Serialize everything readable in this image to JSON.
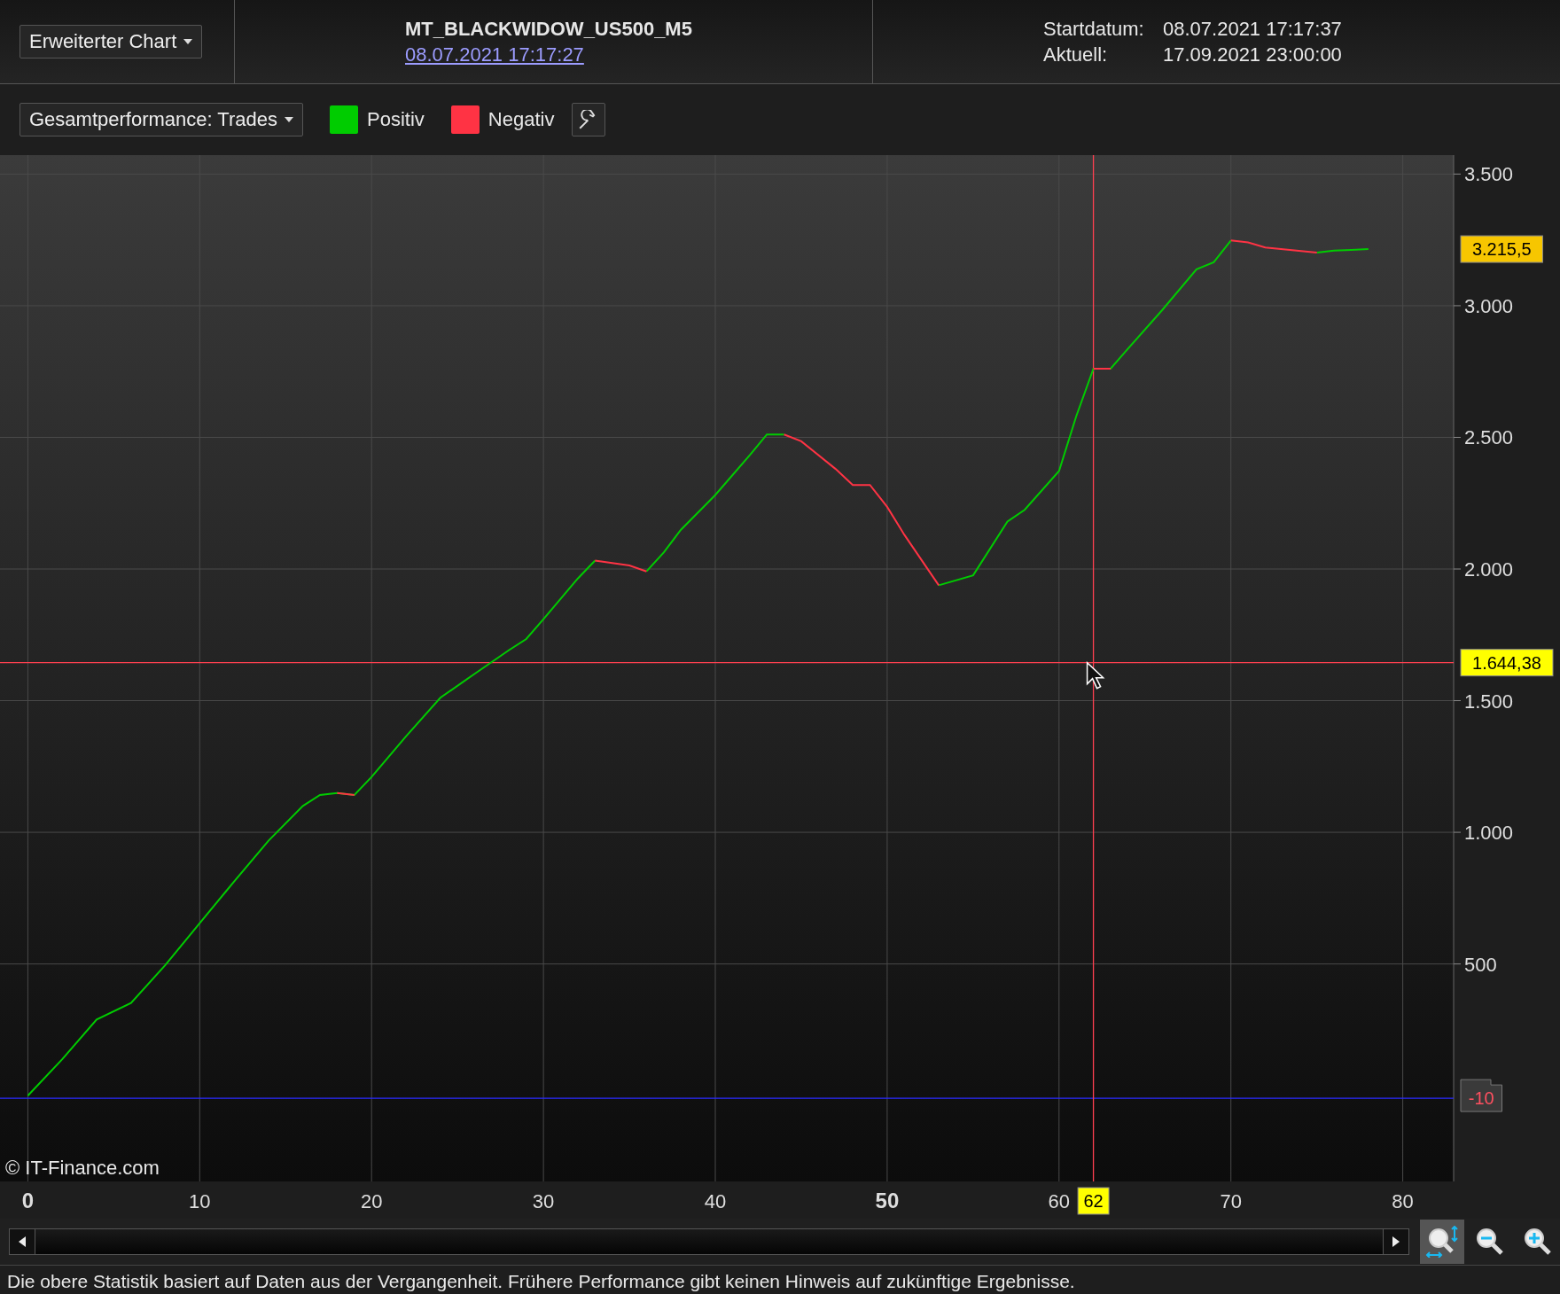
{
  "header": {
    "chart_menu": "Erweiterter Chart",
    "title": "MT_BLACKWIDOW_US500_M5",
    "date_link": "08.07.2021 17:17:27",
    "info": [
      {
        "label": "Startdatum:",
        "value": "08.07.2021 17:17:37"
      },
      {
        "label": "Aktuell:",
        "value": "17.09.2021 23:00:00"
      }
    ]
  },
  "toolbar": {
    "view_menu": "Gesamtperformance: Trades"
  },
  "chart": {
    "copyright": "© IT-Finance.com",
    "chart_data": {
      "type": "line",
      "x": [
        0,
        2,
        4,
        6,
        8,
        10,
        12,
        14,
        16,
        17,
        18,
        19,
        20,
        22,
        24,
        26,
        28,
        29,
        30,
        32,
        33,
        35,
        36,
        37,
        38,
        40,
        42,
        43,
        44,
        45,
        47,
        48,
        49,
        50,
        51,
        53,
        55,
        57,
        58,
        60,
        61,
        62,
        63,
        64,
        66,
        68,
        69,
        70,
        71,
        72,
        75,
        76,
        77,
        78
      ],
      "series": [
        {
          "name": "Positiv",
          "color": "#00cc00",
          "values": [
            0,
            138,
            289,
            352,
            496,
            655,
            813,
            968,
            1100,
            1142,
            1149,
            1142,
            1210,
            1364,
            1511,
            1602,
            1692,
            1734,
            1809,
            1964,
            2032,
            null,
            1991,
            2063,
            2149,
            2281,
            2432,
            2511,
            2511,
            null,
            null,
            null,
            null,
            null,
            null,
            1938,
            1976,
            2180,
            2225,
            2372,
            2580,
            2761,
            2761,
            2836,
            2983,
            3138,
            3165,
            3248,
            null,
            null,
            3202,
            3209,
            3212,
            3215
          ]
        },
        {
          "name": "Negativ",
          "color": "#ff3344",
          "values": [
            null,
            null,
            null,
            null,
            null,
            null,
            null,
            null,
            null,
            null,
            1149,
            1142,
            null,
            null,
            null,
            null,
            null,
            null,
            null,
            null,
            2032,
            2013,
            1991,
            null,
            null,
            null,
            null,
            null,
            2511,
            2485,
            2380,
            2319,
            2319,
            2236,
            2130,
            1938,
            null,
            null,
            null,
            null,
            null,
            2761,
            2761,
            null,
            null,
            null,
            null,
            3248,
            3240,
            3221,
            3202,
            null,
            null,
            null
          ]
        }
      ],
      "xlim": [
        -1.62,
        82.96
      ],
      "ylim": [
        -326,
        3572
      ],
      "grid": true,
      "xticks": [
        0,
        10,
        20,
        30,
        40,
        50,
        60,
        70,
        80
      ],
      "yticks": [
        {
          "value": 500,
          "label": "500"
        },
        {
          "value": 1000,
          "label": "1.000"
        },
        {
          "value": 1500,
          "label": "1.500"
        },
        {
          "value": 2000,
          "label": "2.000"
        },
        {
          "value": 2500,
          "label": "2.500"
        },
        {
          "value": 3000,
          "label": "3.000"
        },
        {
          "value": 3500,
          "label": "3.500"
        }
      ],
      "ref_lines": [
        {
          "axis": "y",
          "value": 1644.38,
          "label": "1.644,38",
          "color": "#ff4050"
        },
        {
          "axis": "y",
          "value": -10,
          "label": "-10",
          "color": "#2a2aff"
        },
        {
          "axis": "x",
          "value": 62,
          "label": "62",
          "color": "#ff4050"
        }
      ],
      "annotations": [
        "3.215,5"
      ]
    }
  },
  "zoom_tools": [
    {
      "kind": "fit",
      "selected": true
    },
    {
      "kind": "zoom-out",
      "selected": false
    },
    {
      "kind": "zoom-in",
      "selected": false
    }
  ],
  "status_bar": "Die obere Statistik basiert auf Daten aus der Vergangenheit. Frühere Performance gibt keinen Hinweis auf zukünftige Ergebnisse."
}
